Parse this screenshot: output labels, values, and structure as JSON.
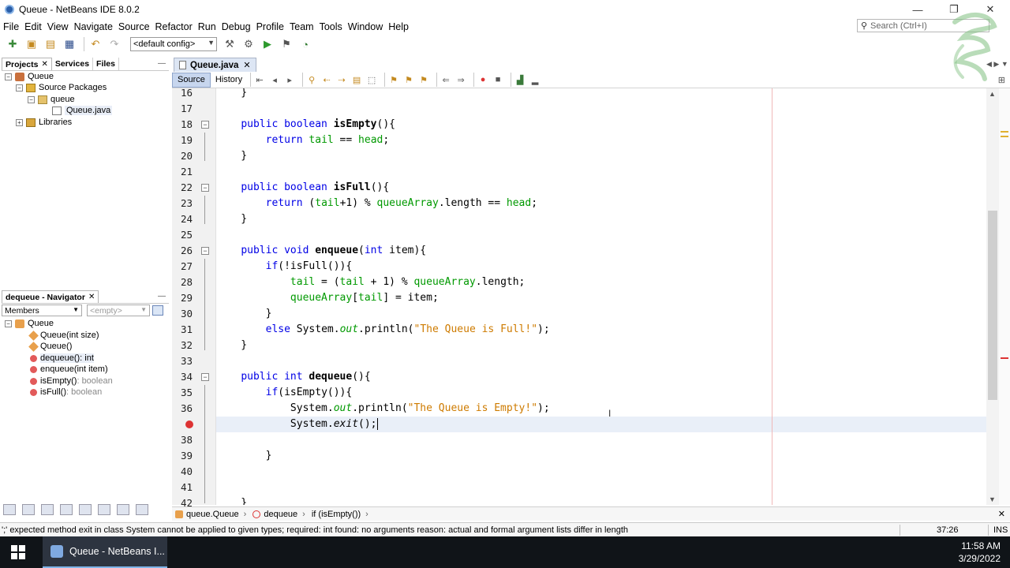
{
  "window": {
    "title": "Queue - NetBeans IDE 8.0.2"
  },
  "menu": [
    "File",
    "Edit",
    "View",
    "Navigate",
    "Source",
    "Refactor",
    "Run",
    "Debug",
    "Profile",
    "Team",
    "Tools",
    "Window",
    "Help"
  ],
  "search": {
    "placeholder": "Search (Ctrl+I)"
  },
  "toolbar": {
    "config": "<default config>"
  },
  "projects_panel": {
    "tabs": [
      "Projects",
      "Services",
      "Files"
    ],
    "tree": {
      "project": "Queue",
      "source_packages": "Source Packages",
      "package": "queue",
      "file": "Queue.java",
      "libraries": "Libraries"
    }
  },
  "navigator": {
    "title": "dequeue - Navigator",
    "filter": "Members",
    "filter2": "<empty>",
    "class": "Queue",
    "members": [
      {
        "name": "Queue",
        "sig": "(int size)",
        "sig_gray": false
      },
      {
        "name": "Queue",
        "sig": "()",
        "sig_gray": false
      },
      {
        "name": "dequeue()",
        "sig": " : int",
        "sig_gray": false
      },
      {
        "name": "enqueue",
        "sig": "(int item)",
        "sig_gray": false
      },
      {
        "name": "isEmpty()",
        "sig": " : boolean",
        "sig_gray": true
      },
      {
        "name": "isFull()",
        "sig": " : boolean",
        "sig_gray": true
      }
    ]
  },
  "editor": {
    "tab": "Queue.java",
    "source_btn": "Source",
    "history_btn": "History",
    "line_numbers": [
      "16",
      "17",
      "18",
      "19",
      "20",
      "21",
      "22",
      "23",
      "24",
      "25",
      "26",
      "27",
      "28",
      "29",
      "30",
      "31",
      "32",
      "33",
      "34",
      "35",
      "36",
      "",
      "38",
      "39",
      "40",
      "41",
      "42"
    ],
    "code": {
      "l16": "    }",
      "l18a": "    ",
      "l18kw": "public boolean ",
      "l18fn": "isEmpty",
      "l18b": "(){",
      "l19a": "        ",
      "l19kw": "return ",
      "l19f1": "tail",
      "l19b": " == ",
      "l19f2": "head",
      "l19c": ";",
      "l20": "    }",
      "l22a": "    ",
      "l22kw": "public boolean ",
      "l22fn": "isFull",
      "l22b": "(){",
      "l23a": "        ",
      "l23kw": "return ",
      "l23b": "(",
      "l23f1": "tail",
      "l23c": "+1) % ",
      "l23f2": "queueArray",
      "l23d": ".length == ",
      "l23f3": "head",
      "l23e": ";",
      "l24": "    }",
      "l26a": "    ",
      "l26kw": "public void ",
      "l26fn": "enqueue",
      "l26b": "(",
      "l26kw2": "int ",
      "l26c": "item){",
      "l27a": "        ",
      "l27kw": "if",
      "l27b": "(!isFull()){",
      "l28a": "            ",
      "l28f1": "tail",
      "l28b": " = (",
      "l28f2": "tail",
      "l28c": " + 1) % ",
      "l28f3": "queueArray",
      "l28d": ".length;",
      "l29a": "            ",
      "l29f1": "queueArray",
      "l29b": "[",
      "l29f2": "tail",
      "l29c": "] = item;",
      "l30": "        }",
      "l31a": "        ",
      "l31kw": "else ",
      "l31b": "System.",
      "l31i": "out",
      "l31c": ".println(",
      "l31s": "\"The Queue is Full!\"",
      "l31d": ");",
      "l32": "    }",
      "l34a": "    ",
      "l34kw": "public int ",
      "l34fn": "dequeue",
      "l34b": "(){",
      "l35a": "        ",
      "l35kw": "if",
      "l35b": "(isEmpty()){",
      "l36a": "            ",
      "l36b": "System.",
      "l36i": "out",
      "l36c": ".println(",
      "l36s": "\"The Queue is Empty!\"",
      "l36d": ");",
      "l37a": "            ",
      "l37b": "System.",
      "l37i": "exit",
      "l37c": "();",
      "l39": "        }",
      "l42": "    }"
    }
  },
  "breadcrumbs": [
    "queue.Queue",
    "dequeue",
    "if (isEmpty())"
  ],
  "status": {
    "message": "';' expected  method exit in class System cannot be applied to given types;   required: int   found: no arguments   reason: actual and formal argument lists differ in length",
    "position": "37:26",
    "mode": "INS"
  },
  "taskbar": {
    "item": "Queue - NetBeans I...",
    "time": "11:58 AM",
    "date": "3/29/2022"
  },
  "colors": {
    "keyword": "#0000e6",
    "field": "#009900",
    "string": "#ce7b00",
    "error": "#dd3333"
  }
}
